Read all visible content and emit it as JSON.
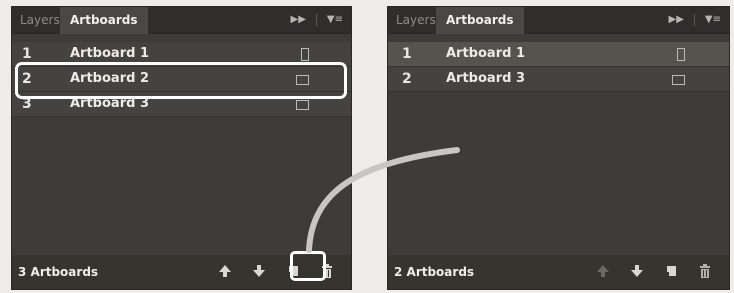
{
  "left_panel": {
    "tabs": [
      {
        "label": "Layers",
        "active": false
      },
      {
        "label": "Artboards",
        "active": true
      }
    ],
    "rows": [
      {
        "num": "1",
        "name": "Artboard 1",
        "selected": false
      },
      {
        "num": "2",
        "name": "Artboard 2",
        "selected": false,
        "highlighted": true
      },
      {
        "num": "3",
        "name": "Artboard 3",
        "selected": false
      }
    ],
    "footer_count": "3 Artboards",
    "footer_buttons": [
      "move-up-icon",
      "move-down-icon",
      "new-artboard-icon",
      "trash-icon"
    ]
  },
  "right_panel": {
    "tabs": [
      {
        "label": "Layers",
        "active": false
      },
      {
        "label": "Artboards",
        "active": true
      }
    ],
    "rows": [
      {
        "num": "1",
        "name": "Artboard 1",
        "selected": true
      },
      {
        "num": "2",
        "name": "Artboard 3",
        "selected": false
      }
    ],
    "footer_count": "2 Artboards",
    "footer_buttons": [
      "move-up-icon",
      "move-down-icon",
      "new-artboard-icon",
      "trash-icon"
    ]
  },
  "colors": {
    "panel_bg": "#3e3c39",
    "callout": "#ffffff",
    "connector": "#c8c6c2"
  }
}
